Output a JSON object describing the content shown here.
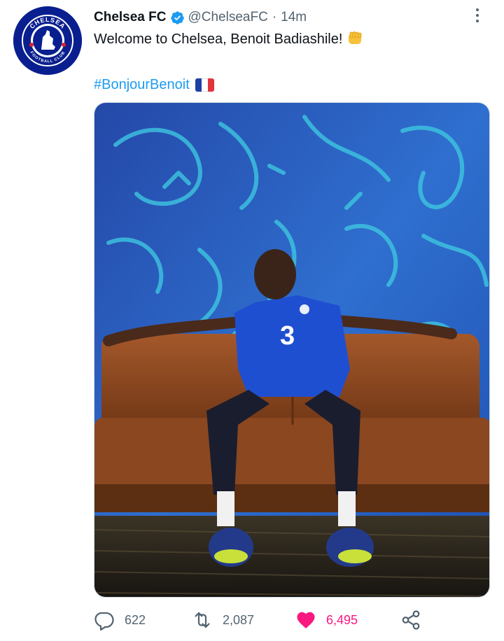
{
  "tweet": {
    "author_name": "Chelsea FC",
    "handle": "@ChelseaFC",
    "separator": "·",
    "time": "14m",
    "text": "Welcome to Chelsea, Benoit Badiashile!",
    "hashtag": "#BonjourBenoit",
    "avatar_text_top": "CHELSEA",
    "avatar_text_bottom": "FOOTBALL CLUB"
  },
  "actions": {
    "replies": "622",
    "retweets": "2,087",
    "likes": "6,495"
  },
  "icons": {
    "verified": "verified-badge-icon",
    "more": "more-options-icon",
    "reply": "reply-icon",
    "retweet": "retweet-icon",
    "like": "heart-icon",
    "share": "share-icon",
    "emoji": "oncoming-fist-emoji",
    "flag": "france-flag-emoji"
  },
  "colors": {
    "brand_blue": "#1d9bf0",
    "like_pink": "#f91880",
    "muted": "#536471",
    "chelsea_blue": "#0a1f8f"
  }
}
